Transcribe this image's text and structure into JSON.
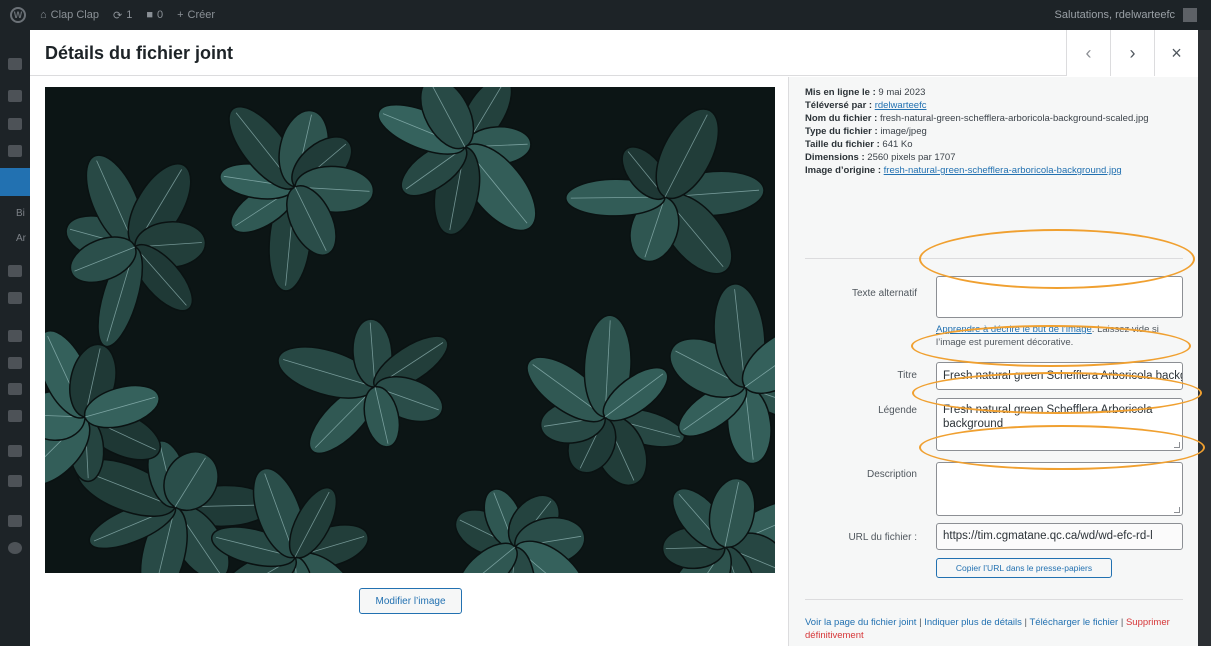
{
  "adminbar": {
    "site_name": "Clap Clap",
    "updates_count": "1",
    "comments_count": "0",
    "new_label": "Créer",
    "greeting": "Salutations, rdelwarteefc"
  },
  "adminmenu": {
    "visible_text_1": "Bi",
    "visible_text_2": "Ar"
  },
  "modal": {
    "title": "Détails du fichier joint",
    "prev_icon": "‹",
    "next_icon": "›",
    "close_icon": "×"
  },
  "preview": {
    "edit_button": "Modifier l’image"
  },
  "details": {
    "uploaded_on_label": "Mis en ligne le :",
    "uploaded_on_value": "9 mai 2023",
    "uploaded_by_label": "Téléversé par :",
    "uploaded_by_value": "rdelwarteefc",
    "filename_label": "Nom du fichier :",
    "filename_value": "fresh-natural-green-schefflera-arboricola-background-scaled.jpg",
    "filetype_label": "Type du fichier :",
    "filetype_value": "image/jpeg",
    "filesize_label": "Taille du fichier :",
    "filesize_value": "641 Ko",
    "dimensions_label": "Dimensions :",
    "dimensions_value": "2560 pixels par 1707",
    "original_label": "Image d’origine :",
    "original_value": "fresh-natural-green-schefflera-arboricola-background.jpg"
  },
  "fields": {
    "alt_label": "Texte alternatif",
    "alt_value": "",
    "alt_help_link": "Apprendre à décrire le but de l’image",
    "alt_help_text": ". Laissez vide si l’image est purement décorative.",
    "title_label": "Titre",
    "title_value": "Fresh natural green Schefflera Arboricola background",
    "caption_label": "Légende",
    "caption_value": "Fresh natural green Schefflera Arboricola background",
    "description_label": "Description",
    "description_value": "",
    "url_label": "URL du fichier :",
    "url_value": "https://tim.cgmatane.qc.ca/wd/wd-efc-rd-l",
    "copy_button": "Copier l’URL dans le presse-papiers"
  },
  "actions": {
    "view_page": "Voir la page du fichier joint",
    "more_details": "Indiquer plus de détails",
    "download": "Télécharger le fichier",
    "delete": "Supprimer définitivement",
    "sep": " | "
  },
  "colors": {
    "annotation": "#f0a030",
    "link": "#2271b1",
    "danger": "#d63638"
  }
}
